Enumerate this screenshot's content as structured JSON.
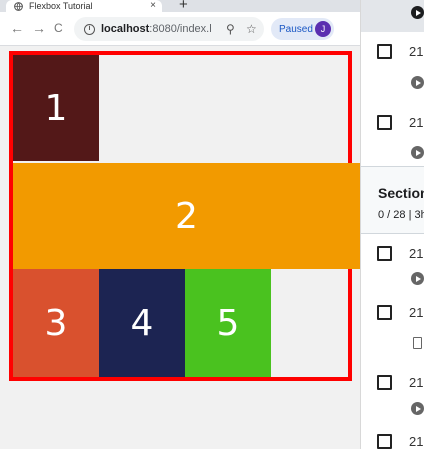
{
  "browser": {
    "tab_title": "Flexbox Tutorial",
    "tab_close": "×",
    "new_tab": "+",
    "back": "←",
    "forward": "→",
    "reload": "C",
    "url_host": "localhost",
    "url_rest": ":8080/index.h...",
    "zoom_icon": "⚲",
    "star_icon": "☆",
    "profile_label": "Paused",
    "profile_initial": "J",
    "menu_icon": "⋮"
  },
  "flex_items": [
    {
      "label": "1",
      "color": "#531818"
    },
    {
      "label": "2",
      "color": "#f29a00"
    },
    {
      "label": "3",
      "color": "#d9512e"
    },
    {
      "label": "4",
      "color": "#1c2452"
    },
    {
      "label": "5",
      "color": "#4ac21f"
    }
  ],
  "container_border_color": "#ff0000",
  "course_panel": {
    "items": [
      "21",
      "21",
      "21",
      "21",
      "21",
      "21"
    ],
    "section_title": "Section",
    "section_progress": "0 / 28 | 3h"
  }
}
